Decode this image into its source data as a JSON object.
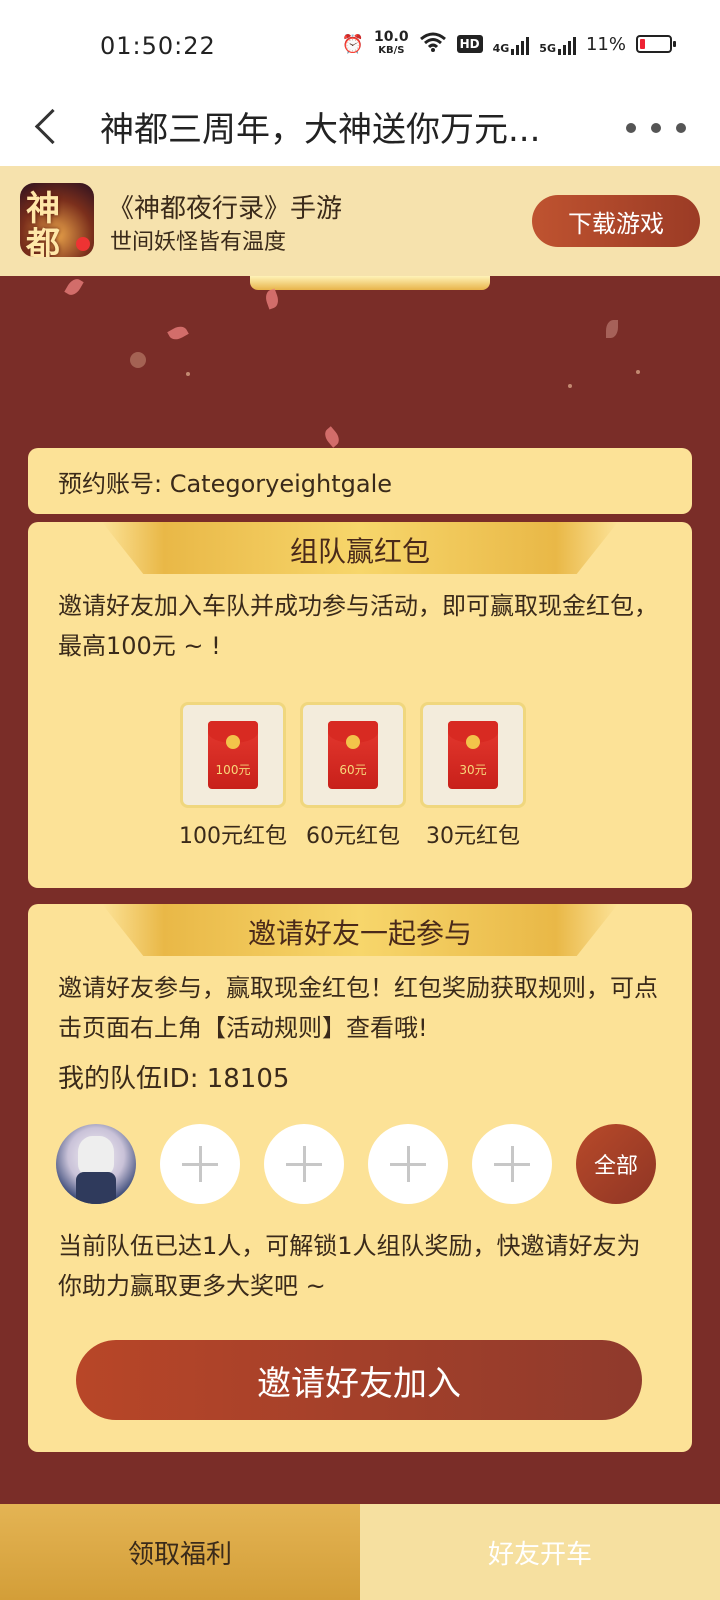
{
  "status_bar": {
    "time": "01:50:22",
    "net_speed": "10.0",
    "net_unit": "KB/S",
    "hd": "HD",
    "sig1": "4G",
    "sig2": "5G",
    "battery": "11%"
  },
  "header": {
    "title": "神都三周年，大神送你万元..."
  },
  "game_banner": {
    "icon_text": "神都",
    "name": "《神都夜行录》手游",
    "slogan": "世间妖怪皆有温度",
    "download_label": "下载游戏"
  },
  "account": {
    "text": "预约账号: Categoryeightgale"
  },
  "team_reward": {
    "title": "组队赢红包",
    "description": "邀请好友加入车队并成功参与活动，即可赢取现金红包，最高100元 ~ !",
    "rewards": [
      {
        "amount": "100元",
        "label": "100元红包"
      },
      {
        "amount": "60元",
        "label": "60元红包"
      },
      {
        "amount": "30元",
        "label": "30元红包"
      }
    ]
  },
  "invite": {
    "title": "邀请好友一起参与",
    "description": "邀请好友参与，赢取现金红包！红包奖励获取规则，可点击页面右上角【活动规则】查看哦!",
    "team_id": "我的队伍ID: 18105",
    "all_label": "全部",
    "progress_text": "当前队伍已达1人，可解锁1人组队奖励，快邀请好友为你助力赢取更多大奖吧 ~",
    "invite_button": "邀请好友加入"
  },
  "tabs": {
    "welfare": "领取福利",
    "friends": "好友开车"
  },
  "colors": {
    "accent": "#7a2d28",
    "card": "#fce297",
    "button": "#b84628"
  }
}
